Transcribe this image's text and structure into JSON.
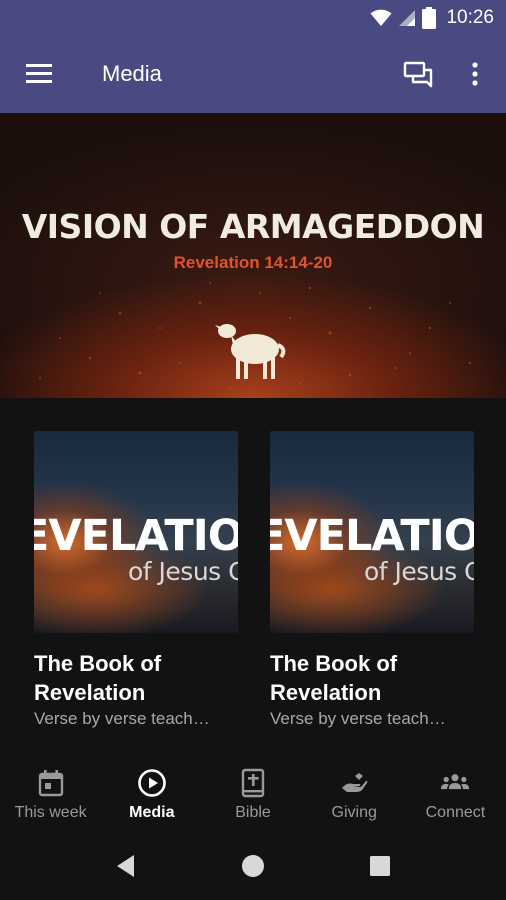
{
  "status_bar": {
    "time": "10:26"
  },
  "app_bar": {
    "title": "Media"
  },
  "banner": {
    "title": "VISION OF ARMAGEDDON",
    "subtitle": "Revelation 14:14-20"
  },
  "cards": [
    {
      "thumb_big": "EVELATIO",
      "thumb_small": "of Jesus Cl",
      "title": "The Book of Revelation",
      "description": "Verse by verse teach…"
    },
    {
      "thumb_big": "EVELATIO",
      "thumb_small": "of Jesus Cl",
      "title": "The Book of Revelation",
      "description": "Verse by verse teach…"
    }
  ],
  "bottom_nav": {
    "items": [
      {
        "label": "This week",
        "icon": "calendar-icon",
        "active": false
      },
      {
        "label": "Media",
        "icon": "play-circle-icon",
        "active": true
      },
      {
        "label": "Bible",
        "icon": "bible-icon",
        "active": false
      },
      {
        "label": "Giving",
        "icon": "giving-hand-icon",
        "active": false
      },
      {
        "label": "Connect",
        "icon": "group-icon",
        "active": false
      }
    ]
  },
  "colors": {
    "app_bar": "#4a4a82",
    "background": "#121212",
    "accent_subtitle": "#e0542c"
  }
}
